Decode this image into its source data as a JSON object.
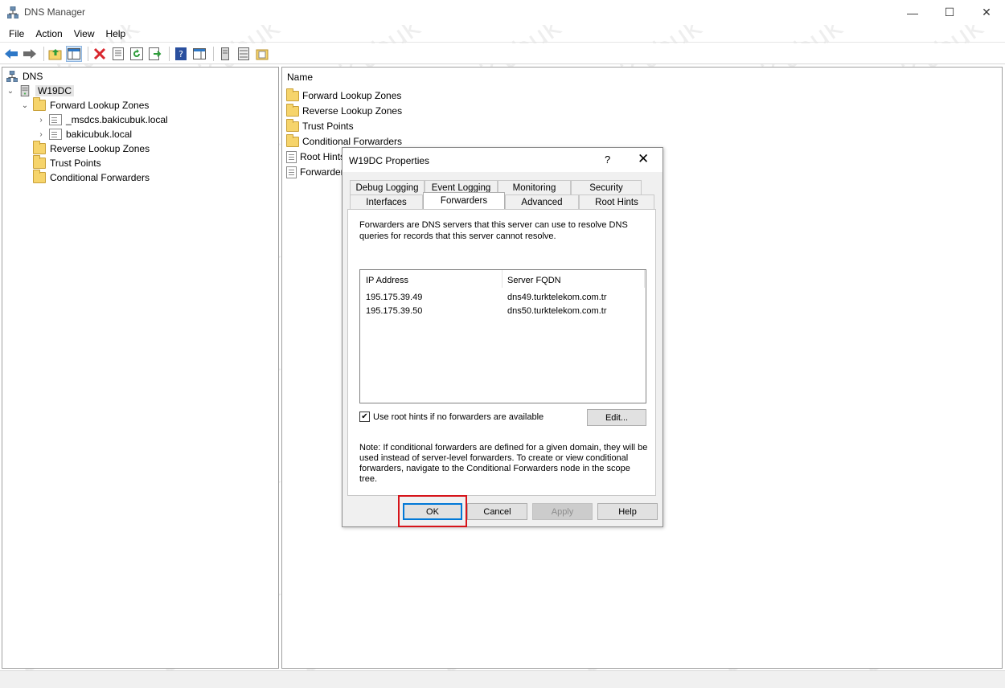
{
  "window": {
    "title": "DNS Manager",
    "min_glyph": "—",
    "max_glyph": "☐",
    "close_glyph": "✕"
  },
  "menu": [
    "File",
    "Action",
    "View",
    "Help"
  ],
  "toolbar": [
    "back-icon",
    "forward-icon",
    "up-folder-icon",
    "show-hide-tree-icon",
    "delete-icon",
    "properties-icon",
    "refresh-icon",
    "export-list-icon",
    "help-icon",
    "show-action-pane-icon",
    "server-icon",
    "records-icon",
    "zone-icon"
  ],
  "tree": {
    "root": "DNS",
    "server": "W19DC",
    "forward_zones": "Forward Lookup Zones",
    "zone1": "_msdcs.bakicubuk.local",
    "zone2": "bakicubuk.local",
    "reverse_zones": "Reverse Lookup Zones",
    "trust_points": "Trust Points",
    "conditional_forwarders": "Conditional Forwarders"
  },
  "list": {
    "header": "Name",
    "items": [
      "Forward Lookup Zones",
      "Reverse Lookup Zones",
      "Trust Points",
      "Conditional Forwarders",
      "Root Hints",
      "Forwarders"
    ]
  },
  "dialog": {
    "title": "W19DC Properties",
    "help_glyph": "?",
    "close_glyph": "✕",
    "tabs_row1": [
      "Debug Logging",
      "Event Logging",
      "Monitoring",
      "Security"
    ],
    "tabs_row2": [
      "Interfaces",
      "Forwarders",
      "Advanced",
      "Root Hints"
    ],
    "active_tab": "Forwarders",
    "description": "Forwarders are DNS servers that this server can use to resolve DNS queries for records that this server cannot resolve.",
    "columns": [
      "IP Address",
      "Server FQDN"
    ],
    "forwarders": [
      {
        "ip": "195.175.39.49",
        "fqdn": "dns49.turktelekom.com.tr"
      },
      {
        "ip": "195.175.39.50",
        "fqdn": "dns50.turktelekom.com.tr"
      }
    ],
    "use_root_hints_label": "Use root hints if no forwarders are available",
    "use_root_hints_checked": true,
    "edit_button": "Edit...",
    "note": "Note: If conditional forwarders are defined for a given domain, they will be used instead of server-level forwarders.  To create or view conditional forwarders, navigate to the Conditional Forwarders node in the scope tree.",
    "ok": "OK",
    "cancel": "Cancel",
    "apply": "Apply",
    "help": "Help"
  },
  "colors": {
    "highlight": "#d6141a",
    "focus": "#0078d7",
    "folder": "#f6d46b"
  }
}
